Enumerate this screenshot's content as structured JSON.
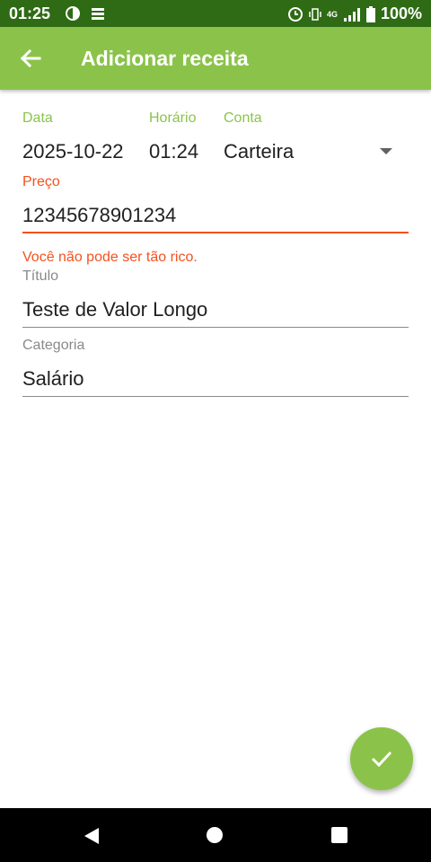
{
  "status_bar": {
    "time": "01:25",
    "battery_text": "100%",
    "network_label": "4G"
  },
  "app_bar": {
    "title": "Adicionar receita",
    "back_icon": "arrow-left-icon"
  },
  "form": {
    "date": {
      "label": "Data",
      "value": "2025-10-22"
    },
    "time": {
      "label": "Horário",
      "value": "01:24"
    },
    "account": {
      "label": "Conta",
      "value": "Carteira"
    },
    "price": {
      "label": "Preço",
      "value": "12345678901234",
      "error": "Você não pode ser tão rico."
    },
    "title": {
      "label": "Título",
      "value": "Teste de Valor Longo"
    },
    "category": {
      "label": "Categoria",
      "value": "Salário"
    }
  },
  "fab": {
    "icon": "check-icon"
  },
  "colors": {
    "status_bar": "#2e6b14",
    "primary": "#8bc34a",
    "error": "#f4511e",
    "text": "#212121",
    "hint": "#8a8a8a"
  }
}
